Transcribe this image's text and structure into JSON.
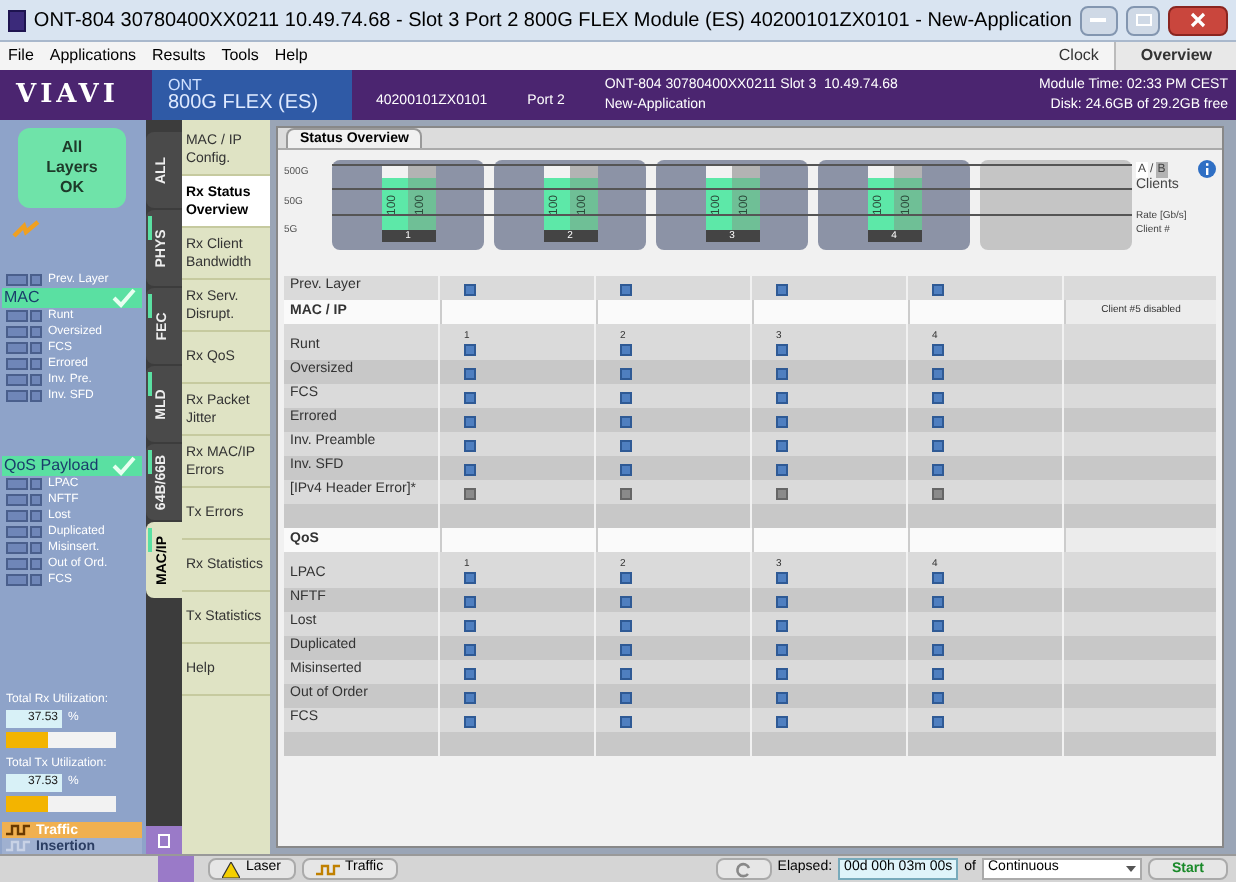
{
  "window": {
    "title": "ONT-804  30780400XX0211 10.49.74.68 - Slot 3 Port 2 800G FLEX Module (ES) 40200101ZX0101 - New-Application"
  },
  "menu": [
    "File",
    "Applications",
    "Results",
    "Tools",
    "Help"
  ],
  "toolbar": {
    "clock": "Clock",
    "overview": "Overview"
  },
  "header": {
    "logo": "VIAVI",
    "product_line": "ONT",
    "module": "800G FLEX (ES)",
    "serial": "40200101ZX0101",
    "port": "Port 2",
    "device": "ONT-804 30780400XX0211 Slot 3  10.49.74.68",
    "application": "New-Application",
    "module_time": "Module Time: 02:33 PM CEST",
    "disk": "Disk: 24.6GB of 29.2GB free"
  },
  "left_panel": {
    "status": "All Layers OK",
    "sections": [
      {
        "items": [
          "Prev. Layer"
        ]
      },
      {
        "title": "MAC",
        "checked": true,
        "items": [
          "Runt",
          "Oversized",
          "FCS",
          "Errored",
          "Inv. Pre.",
          "Inv. SFD"
        ]
      },
      {
        "title": "QoS Payload",
        "checked": true,
        "items": [
          "LPAC",
          "NFTF",
          "Lost",
          "Duplicated",
          "Misinsert.",
          "Out of Ord.",
          "FCS"
        ]
      }
    ],
    "utilization": [
      {
        "label": "Total Rx Utilization:",
        "value": "37.53",
        "unit": "%",
        "level": 0.375
      },
      {
        "label": "Total Tx Utilization:",
        "value": "37.53",
        "unit": "%",
        "level": 0.375
      }
    ],
    "modes": [
      {
        "label": "Traffic",
        "selected": true
      },
      {
        "label": "Insertion",
        "selected": false
      }
    ]
  },
  "vertical_tabs": [
    {
      "label": "ALL",
      "selected": false,
      "indicator": false
    },
    {
      "label": "PHYS",
      "selected": false,
      "indicator": true
    },
    {
      "label": "FEC",
      "selected": false,
      "indicator": true
    },
    {
      "label": "MLD",
      "selected": false,
      "indicator": true
    },
    {
      "label": "64B/66B",
      "selected": false,
      "indicator": true
    },
    {
      "label": "MAC/IP",
      "selected": true,
      "indicator": true
    }
  ],
  "nav": [
    {
      "label": "MAC / IP Config.",
      "selected": false
    },
    {
      "label": "Rx Status Overview",
      "selected": true
    },
    {
      "label": "Rx Client Bandwidth",
      "selected": false
    },
    {
      "label": "Rx Serv. Disrupt.",
      "selected": false
    },
    {
      "label": "Rx QoS",
      "selected": false
    },
    {
      "label": "Rx Packet Jitter",
      "selected": false
    },
    {
      "label": "Rx MAC/IP Errors",
      "selected": false
    },
    {
      "label": "Tx Errors",
      "selected": false
    },
    {
      "label": "Rx Statistics",
      "selected": false
    },
    {
      "label": "Tx Statistics",
      "selected": false
    },
    {
      "label": "Help",
      "selected": false
    }
  ],
  "overview": {
    "tab": "Status Overview",
    "scale": [
      "500G",
      "50G",
      "5G"
    ],
    "clients": [
      {
        "number": "1",
        "rate_a": "100",
        "rate_b": "100",
        "enabled": true
      },
      {
        "number": "2",
        "rate_a": "100",
        "rate_b": "100",
        "enabled": true
      },
      {
        "number": "3",
        "rate_a": "100",
        "rate_b": "100",
        "enabled": true
      },
      {
        "number": "4",
        "rate_a": "100",
        "rate_b": "100",
        "enabled": true
      },
      {
        "enabled": false
      }
    ],
    "legend": {
      "a": "A",
      "separator": "/",
      "b": "B",
      "clients": "Clients",
      "rate": "Rate [Gb/s]",
      "client_number": "Client #"
    }
  },
  "table": {
    "sections": [
      {
        "rows": [
          {
            "label": "Prev. Layer",
            "cells": [
              {
                "active": true
              },
              {
                "active": true
              },
              {
                "active": true
              },
              {
                "active": true
              }
            ]
          }
        ]
      },
      {
        "title": "MAC / IP",
        "note": "Client #5 disabled",
        "numbers": [
          "1",
          "2",
          "3",
          "4"
        ],
        "rows": [
          {
            "label": "Runt",
            "cells": [
              {
                "active": true
              },
              {
                "active": true
              },
              {
                "active": true
              },
              {
                "active": true
              }
            ]
          },
          {
            "label": "Oversized",
            "cells": [
              {
                "active": true
              },
              {
                "active": true
              },
              {
                "active": true
              },
              {
                "active": true
              }
            ]
          },
          {
            "label": "FCS",
            "cells": [
              {
                "active": true
              },
              {
                "active": true
              },
              {
                "active": true
              },
              {
                "active": true
              }
            ]
          },
          {
            "label": "Errored",
            "cells": [
              {
                "active": true
              },
              {
                "active": true
              },
              {
                "active": true
              },
              {
                "active": true
              }
            ]
          },
          {
            "label": "Inv. Preamble",
            "cells": [
              {
                "active": true
              },
              {
                "active": true
              },
              {
                "active": true
              },
              {
                "active": true
              }
            ]
          },
          {
            "label": "Inv. SFD",
            "cells": [
              {
                "active": true
              },
              {
                "active": true
              },
              {
                "active": true
              },
              {
                "active": true
              }
            ]
          },
          {
            "label": "[IPv4 Header Error]*",
            "cells": [
              {
                "active": false
              },
              {
                "active": false
              },
              {
                "active": false
              },
              {
                "active": false
              }
            ]
          }
        ]
      },
      {
        "title": "QoS",
        "numbers": [
          "1",
          "2",
          "3",
          "4"
        ],
        "rows": [
          {
            "label": "LPAC",
            "cells": [
              {
                "active": true
              },
              {
                "active": true
              },
              {
                "active": true
              },
              {
                "active": true
              }
            ]
          },
          {
            "label": "NFTF",
            "cells": [
              {
                "active": true
              },
              {
                "active": true
              },
              {
                "active": true
              },
              {
                "active": true
              }
            ]
          },
          {
            "label": "Lost",
            "cells": [
              {
                "active": true
              },
              {
                "active": true
              },
              {
                "active": true
              },
              {
                "active": true
              }
            ]
          },
          {
            "label": "Duplicated",
            "cells": [
              {
                "active": true
              },
              {
                "active": true
              },
              {
                "active": true
              },
              {
                "active": true
              }
            ]
          },
          {
            "label": "Misinserted",
            "cells": [
              {
                "active": true
              },
              {
                "active": true
              },
              {
                "active": true
              },
              {
                "active": true
              }
            ]
          },
          {
            "label": "Out of Order",
            "cells": [
              {
                "active": true
              },
              {
                "active": true
              },
              {
                "active": true
              },
              {
                "active": true
              }
            ]
          },
          {
            "label": "FCS",
            "cells": [
              {
                "active": true
              },
              {
                "active": true
              },
              {
                "active": true
              },
              {
                "active": true
              }
            ]
          }
        ]
      }
    ]
  },
  "bottom_bar": {
    "laser": "Laser",
    "traffic": "Traffic",
    "elapsed_label": "Elapsed:",
    "elapsed": "00d 00h 03m 00s",
    "of": "of",
    "duration": "Continuous",
    "start": "Start"
  }
}
